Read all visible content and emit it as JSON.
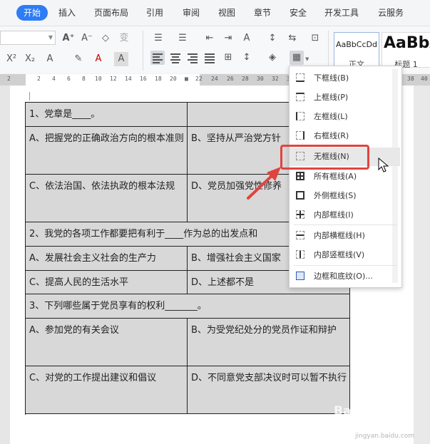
{
  "menu": {
    "items": [
      "开始",
      "插入",
      "页面布局",
      "引用",
      "审阅",
      "视图",
      "章节",
      "安全",
      "开发工具",
      "云服务"
    ],
    "active_index": 0
  },
  "toolbar": {
    "font_name": "",
    "style_normal": {
      "sample": "AaBbCcDd",
      "caption": "正文"
    },
    "style_heading1": {
      "sample": "AaBbA",
      "caption": "标题 1"
    }
  },
  "ruler": {
    "numbers": [
      "2",
      "2",
      "4",
      "6",
      "8",
      "10",
      "12",
      "14",
      "16",
      "18",
      "20",
      "22",
      "24",
      "26",
      "28",
      "30",
      "32",
      "34",
      "36",
      "38",
      "40"
    ]
  },
  "table": {
    "rows": [
      [
        "1、党章是____。",
        ""
      ],
      [
        "A、把握党的正确政治方向的根本准则",
        "B、坚持从严治党方针"
      ],
      [
        "C、依法治国、依法执政的根本法规",
        "D、党员加强党性修养"
      ],
      [
        "2、我党的各项工作都要把有利于____作为总的出发点和",
        ""
      ],
      [
        "A、发展社会主义社会的生产力",
        "B、增强社会主义国家"
      ],
      [
        "C、提高人民的生活水平",
        "D、上述都不是"
      ],
      [
        "3、下列哪些属于党员享有的权利_______。",
        ""
      ],
      [
        "A、参加党的有关会议",
        "B、为受党纪处分的党员作证和辩护"
      ],
      [
        "C、对党的工作提出建议和倡议",
        "D、不同意党支部决议时可以暂不执行"
      ]
    ]
  },
  "border_menu": {
    "items": [
      {
        "label": "下框线(B)",
        "icon": "border-bottom-icon"
      },
      {
        "label": "上框线(P)",
        "icon": "border-top-icon"
      },
      {
        "label": "左框线(L)",
        "icon": "border-left-icon"
      },
      {
        "label": "右框线(R)",
        "icon": "border-right-icon"
      },
      {
        "label": "无框线(N)",
        "icon": "border-none-icon"
      },
      {
        "label": "所有框线(A)",
        "icon": "border-all-icon"
      },
      {
        "label": "外侧框线(S)",
        "icon": "border-outside-icon"
      },
      {
        "label": "内部框线(I)",
        "icon": "border-inside-icon"
      },
      {
        "label": "内部横框线(H)",
        "icon": "border-inside-horizontal-icon"
      },
      {
        "label": "内部竖框线(V)",
        "icon": "border-inside-vertical-icon"
      },
      {
        "label": "边框和底纹(O)...",
        "icon": "borders-shading-icon"
      }
    ],
    "highlighted_index": 4
  },
  "watermark": {
    "text": "Bai 经验",
    "url": "jingyan.baidu.com"
  },
  "colors": {
    "accent": "#2e7cf6",
    "highlight_box": "#e0443e",
    "table_fill": "#d8d8d8"
  }
}
